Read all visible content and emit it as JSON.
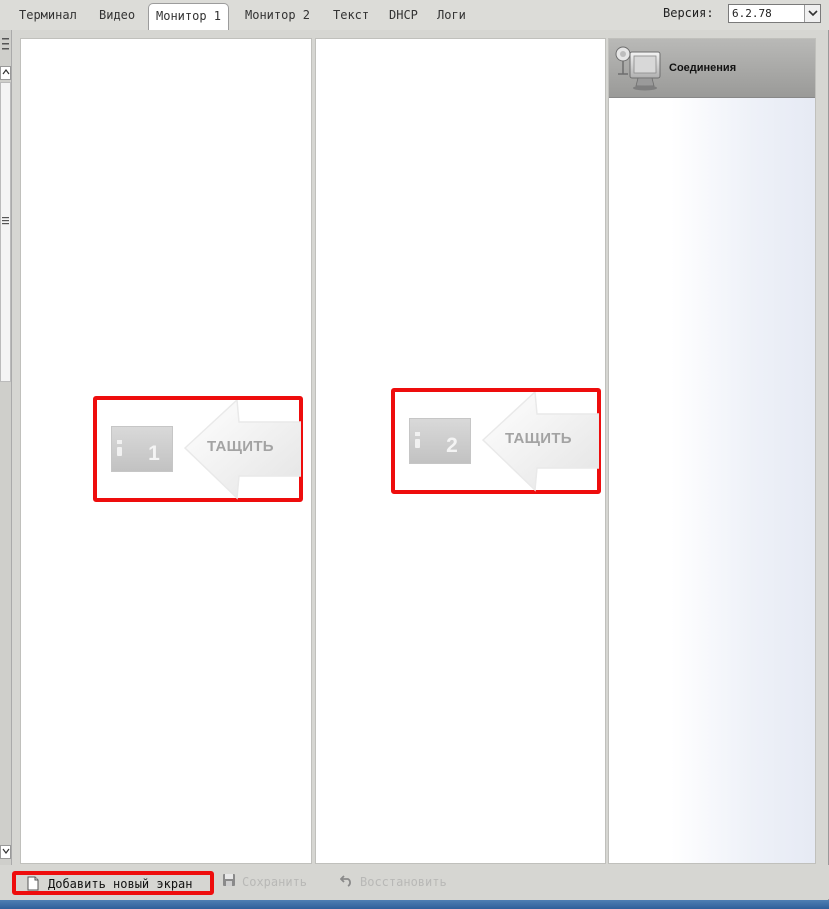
{
  "tabs": [
    {
      "label": "Терминал",
      "active": false
    },
    {
      "label": "Видео",
      "active": false
    },
    {
      "label": "Монитор 1",
      "active": true
    },
    {
      "label": "Монитор 2",
      "active": false
    },
    {
      "label": "Текст",
      "active": false
    },
    {
      "label": "DHCP",
      "active": false
    },
    {
      "label": "Логи",
      "active": false
    }
  ],
  "version": {
    "label": "Версия:",
    "value": "6.2.78"
  },
  "screens": [
    {
      "number": "1",
      "drag_text": "ТАЩИТЬ"
    },
    {
      "number": "2",
      "drag_text": "ТАЩИТЬ"
    }
  ],
  "sidebar": {
    "connections_label": "Соединения",
    "icon": "network-monitor-icon"
  },
  "toolbar": {
    "add_label": "Добавить новый экран",
    "save_label": "Сохранить",
    "restore_label": "Восстановить"
  },
  "colors": {
    "highlight": "#ee0d0d",
    "disabled_text": "#b8b8b6",
    "sidebar_header": "#a8a8a6"
  }
}
